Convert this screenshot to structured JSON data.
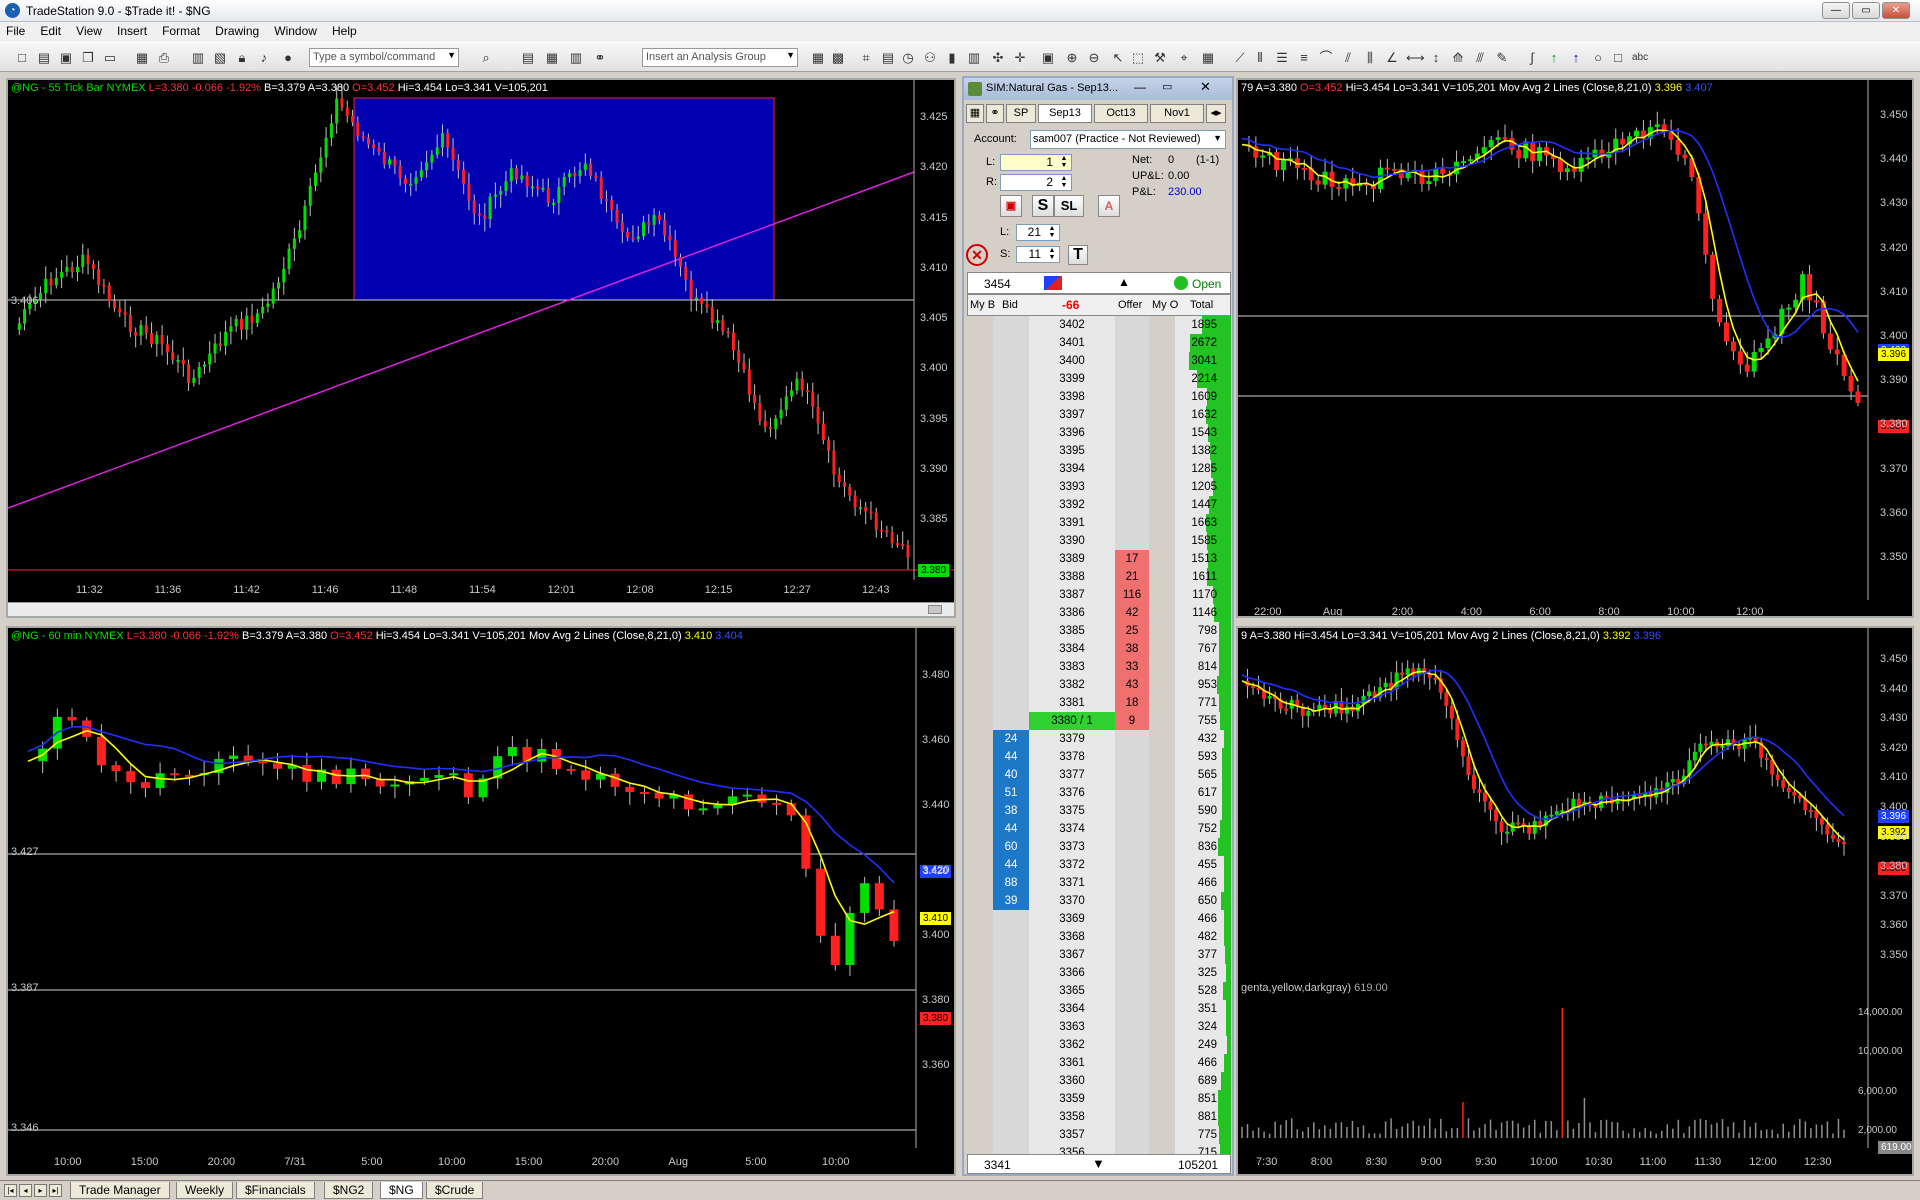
{
  "window": {
    "title": "TradeStation 9.0 - $Trade it! - $NG",
    "minimize": "—",
    "maximize": "▭",
    "close": "✕"
  },
  "menu": [
    "File",
    "Edit",
    "View",
    "Insert",
    "Format",
    "Drawing",
    "Window",
    "Help"
  ],
  "toolbar": {
    "symbol_placeholder": "Type a symbol/command",
    "analysis_placeholder": "Insert an Analysis Group"
  },
  "chart1": {
    "header": "@NG - 55 Tick Bar  NYMEX",
    "last": "L=3.380",
    "chg": "-0.066",
    "pct": "-1.92%",
    "bid": "B=3.379",
    "ask": "A=3.380",
    "open": "O=3.452",
    "hi": "Hi=3.454",
    "lo": "Lo=3.341",
    "vol": "V=105,201",
    "y_ticks": [
      "3.425",
      "3.420",
      "3.415",
      "3.410",
      "3.405",
      "3.400",
      "3.395",
      "3.390",
      "3.385"
    ],
    "x_ticks": [
      "11:32",
      "11:36",
      "11:42",
      "11:46",
      "11:48",
      "11:54",
      "12:01",
      "12:08",
      "12:15",
      "12:27",
      "12:43"
    ],
    "hline_label": "3.406",
    "last_tag": "3.380",
    "colors": {
      "up": "#00e000",
      "down": "#ff2020",
      "box": "#0000b0",
      "trend": "#e020e0"
    }
  },
  "chart2": {
    "header": "@NG - 60 min  NYMEX",
    "last": "L=3.380",
    "chg": "-0.066",
    "pct": "-1.92%",
    "bid": "B=3.379",
    "ask": "A=3.380",
    "open": "O=3.452",
    "hi": "Hi=3.454",
    "lo": "Lo=3.341",
    "vol": "V=105,201",
    "study": "Mov Avg 2 Lines (Close,8,21,0)",
    "ma_fast": "3.410",
    "ma_slow": "3.404",
    "y_ticks": [
      "3.480",
      "3.460",
      "3.440",
      "3.420",
      "3.400",
      "3.380",
      "3.360"
    ],
    "x_ticks": [
      "10:00",
      "15:00",
      "20:00",
      "7/31",
      "5:00",
      "10:00",
      "15:00",
      "20:00",
      "Aug",
      "5:00",
      "10:00"
    ],
    "hlines": [
      "3.427",
      "3.387",
      "3.346"
    ],
    "tags": {
      "ma_slow": "3.420",
      "ma_fast": "3.410",
      "last": "3.380"
    }
  },
  "chart3": {
    "header_tail": "79  A=3.380",
    "open": "O=3.452",
    "hi": "Hi=3.454",
    "lo": "Lo=3.341",
    "vol": "V=105,201",
    "study": "Mov Avg 2 Lines (Close,8,21,0)",
    "ma_fast": "3.396",
    "ma_slow": "3.407",
    "y_ticks": [
      "3.450",
      "3.440",
      "3.430",
      "3.420",
      "3.410",
      "3.400",
      "3.390",
      "3.380",
      "3.370",
      "3.360",
      "3.350"
    ],
    "x_ticks": [
      "22:00",
      "Aug",
      "2:00",
      "4:00",
      "6:00",
      "8:00",
      "10:00",
      "12:00"
    ],
    "tags": {
      "ma_slow": "3.402",
      "ma_fast": "3.396",
      "last": "3.380"
    }
  },
  "chart4": {
    "header_tail": "9  A=3.380",
    "hi": "Hi=3.454",
    "lo": "Lo=3.341",
    "vol": "V=105,201",
    "study": "Mov Avg 2 Lines (Close,8,21,0)",
    "ma_fast": "3.392",
    "ma_slow": "3.396",
    "y_ticks": [
      "3.450",
      "3.440",
      "3.430",
      "3.420",
      "3.410",
      "3.400",
      "3.390",
      "3.380",
      "3.370",
      "3.360",
      "3.350"
    ],
    "vol_ticks": [
      "14,000.00",
      "10,000.00",
      "6,000.00",
      "2,000.00"
    ],
    "vol_study": "genta,yellow,darkgray)",
    "vol_value": "619.00",
    "vol_tag": "619.00",
    "x_ticks": [
      "7:30",
      "8:00",
      "8:30",
      "9:00",
      "9:30",
      "10:00",
      "10:30",
      "11:00",
      "11:30",
      "12:00",
      "12:30"
    ],
    "tags": {
      "ma_slow": "3.396",
      "ma_fast": "3.392",
      "last": "3.380"
    }
  },
  "matrix": {
    "title": "SIM:Natural Gas - Sep13...",
    "tabs": [
      "SP",
      "Sep13",
      "Oct13",
      "Nov1"
    ],
    "account_label": "Account:",
    "account_value": "sam007 (Practice - Not Reviewed)",
    "l_label": "L:",
    "l_value": "1",
    "r_label": "R:",
    "r_value": "2",
    "net_label": "Net:",
    "net_value": "0",
    "net_extra": "(1-1)",
    "upl_label": "UP&L:",
    "upl_value": "0.00",
    "pl_label": "P&L:",
    "pl_value": "230.00",
    "s_btn": "S",
    "sl_btn": "SL",
    "l2_label": "L:",
    "l2_value": "21",
    "s2_label": "S:",
    "s2_value": "11",
    "t_btn": "T",
    "qty": "3454",
    "open_label": "Open",
    "cols": {
      "myb": "My B",
      "bid": "Bid",
      "chg": "-66",
      "offer": "Offer",
      "myo": "My O",
      "total": "Total"
    },
    "footer_low": "3341",
    "footer_total": "105201",
    "rows": [
      {
        "price": "3402",
        "offer": "",
        "total": "1895"
      },
      {
        "price": "3401",
        "offer": "",
        "total": "2672"
      },
      {
        "price": "3400",
        "offer": "",
        "total": "3041"
      },
      {
        "price": "3399",
        "offer": "",
        "total": "2214"
      },
      {
        "price": "3398",
        "offer": "",
        "total": "1609"
      },
      {
        "price": "3397",
        "offer": "",
        "total": "1632"
      },
      {
        "price": "3396",
        "offer": "",
        "total": "1543"
      },
      {
        "price": "3395",
        "offer": "",
        "total": "1382"
      },
      {
        "price": "3394",
        "offer": "",
        "total": "1285"
      },
      {
        "price": "3393",
        "offer": "",
        "total": "1205"
      },
      {
        "price": "3392",
        "offer": "",
        "total": "1447"
      },
      {
        "price": "3391",
        "offer": "",
        "total": "1663"
      },
      {
        "price": "3390",
        "offer": "",
        "total": "1585"
      },
      {
        "price": "3389",
        "offer": "17",
        "total": "1513"
      },
      {
        "price": "3388",
        "offer": "21",
        "total": "1611"
      },
      {
        "price": "3387",
        "offer": "116",
        "total": "1170"
      },
      {
        "price": "3386",
        "offer": "42",
        "total": "1146"
      },
      {
        "price": "3385",
        "offer": "25",
        "total": "798"
      },
      {
        "price": "3384",
        "offer": "38",
        "total": "767"
      },
      {
        "price": "3383",
        "offer": "33",
        "total": "814"
      },
      {
        "price": "3382",
        "offer": "43",
        "total": "953"
      },
      {
        "price": "3381",
        "offer": "18",
        "total": "771"
      },
      {
        "price": "3380 / 1",
        "offer": "9",
        "total": "755"
      },
      {
        "price": "3379",
        "bid": "24",
        "total": "432"
      },
      {
        "price": "3378",
        "bid": "44",
        "total": "593"
      },
      {
        "price": "3377",
        "bid": "40",
        "total": "565"
      },
      {
        "price": "3376",
        "bid": "51",
        "total": "617"
      },
      {
        "price": "3375",
        "bid": "38",
        "total": "590"
      },
      {
        "price": "3374",
        "bid": "44",
        "total": "752"
      },
      {
        "price": "3373",
        "bid": "60",
        "total": "836"
      },
      {
        "price": "3372",
        "bid": "44",
        "total": "455"
      },
      {
        "price": "3371",
        "bid": "88",
        "total": "466"
      },
      {
        "price": "3370",
        "bid": "39",
        "total": "650"
      },
      {
        "price": "3369",
        "total": "466"
      },
      {
        "price": "3368",
        "total": "482"
      },
      {
        "price": "3367",
        "total": "377"
      },
      {
        "price": "3366",
        "total": "325"
      },
      {
        "price": "3365",
        "total": "528"
      },
      {
        "price": "3364",
        "total": "351"
      },
      {
        "price": "3363",
        "total": "324"
      },
      {
        "price": "3362",
        "total": "249"
      },
      {
        "price": "3361",
        "total": "466"
      },
      {
        "price": "3360",
        "total": "689"
      },
      {
        "price": "3359",
        "total": "851"
      },
      {
        "price": "3358",
        "total": "881"
      },
      {
        "price": "3357",
        "total": "775"
      },
      {
        "price": "3356",
        "total": "715"
      }
    ]
  },
  "sheet_tabs": [
    "Trade Manager",
    "Weekly",
    "$Financials",
    "$NG2",
    "$NG",
    "$Crude"
  ],
  "active_tab": "$NG"
}
